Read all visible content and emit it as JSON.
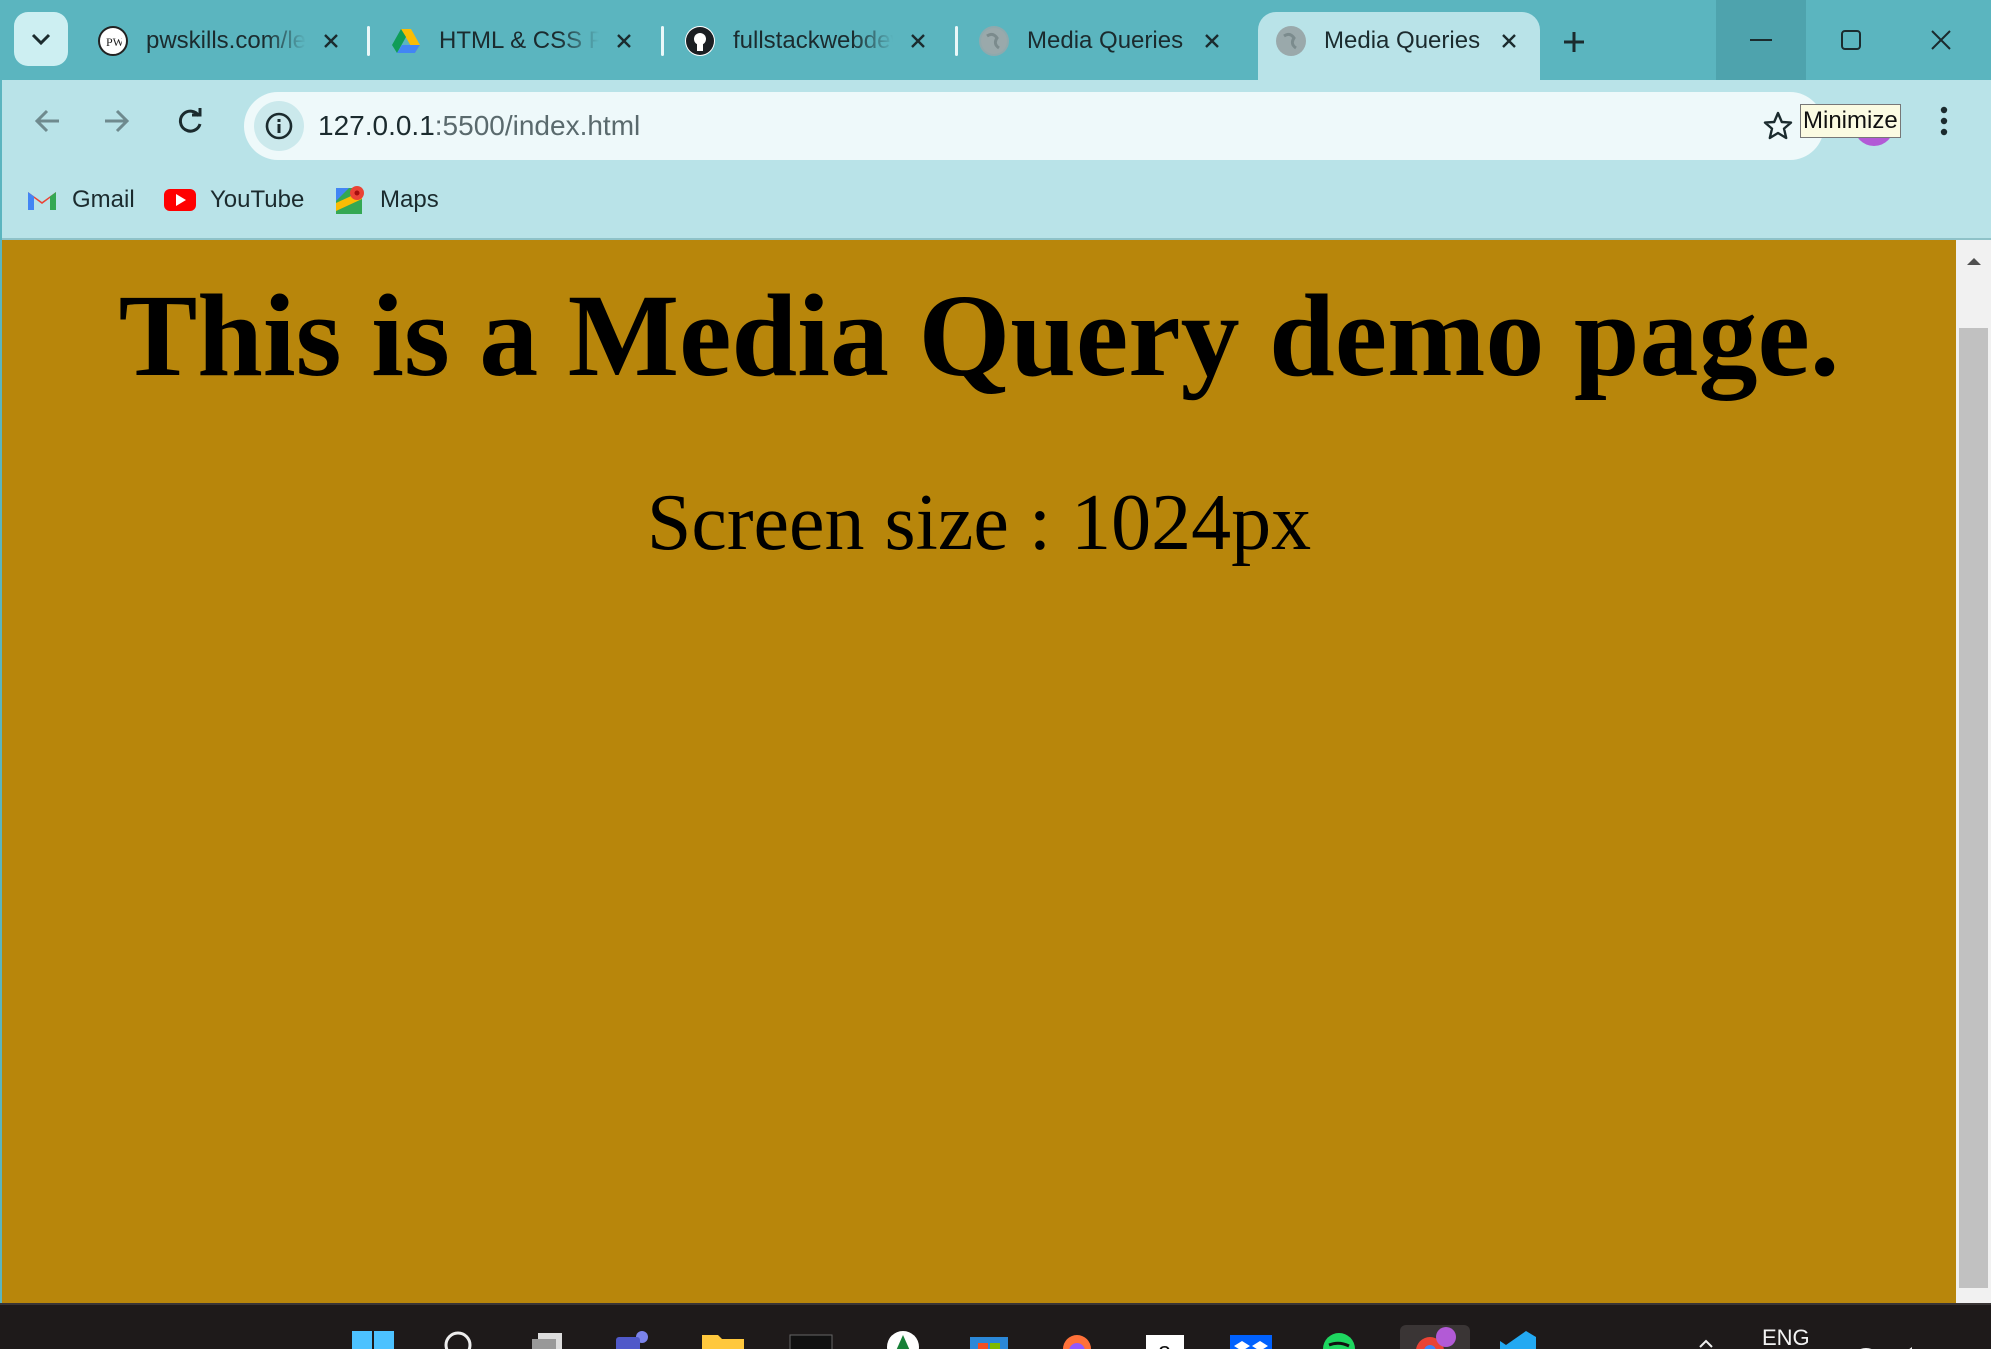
{
  "tabs": [
    {
      "title": "pwskills.com/learn"
    },
    {
      "title": "HTML & CSS Practice"
    },
    {
      "title": "fullstackwebdev"
    },
    {
      "title": "Media Queries"
    },
    {
      "title": "Media Queries"
    }
  ],
  "window_controls": {
    "tooltip": "Minimize"
  },
  "address_bar": {
    "host": "127.0.0.1",
    "path": ":5500/index.html"
  },
  "bookmarks": [
    {
      "label": "Gmail"
    },
    {
      "label": "YouTube"
    },
    {
      "label": "Maps"
    }
  ],
  "page": {
    "heading": "This is a Media Query demo page.",
    "screen_size_text": "Screen size : 1024px",
    "background_color": "#b8860b"
  },
  "taskbar": {
    "language": "ENG"
  },
  "colors": {
    "tab_strip": "#5bb5bf",
    "toolbar": "#b9e3e8",
    "page_bg": "#b8860b"
  }
}
